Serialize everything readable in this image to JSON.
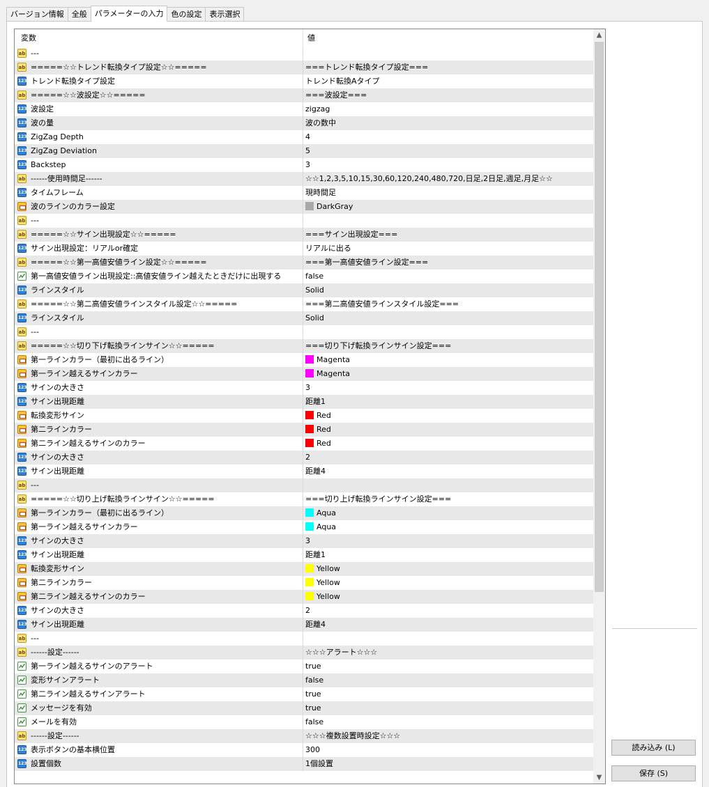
{
  "tabs": [
    {
      "label": "バージョン情報",
      "active": false
    },
    {
      "label": "全般",
      "active": false
    },
    {
      "label": "パラメーターの入力",
      "active": true
    },
    {
      "label": "色の設定",
      "active": false
    },
    {
      "label": "表示選択",
      "active": false
    }
  ],
  "columns": {
    "variable": "変数",
    "value": "値"
  },
  "rows": [
    {
      "type": "string",
      "name": "---",
      "value": ""
    },
    {
      "type": "string",
      "name": "=====☆☆トレンド転換タイプ設定☆☆=====",
      "value": "===トレンド転換タイプ設定==="
    },
    {
      "type": "number",
      "name": "トレンド転換タイプ設定",
      "value": "トレンド転換Aタイプ"
    },
    {
      "type": "string",
      "name": "=====☆☆波設定☆☆=====",
      "value": "===波設定==="
    },
    {
      "type": "number",
      "name": "波設定",
      "value": "zigzag"
    },
    {
      "type": "number",
      "name": "波の量",
      "value": "波の数中"
    },
    {
      "type": "number",
      "name": "ZigZag Depth",
      "value": "4"
    },
    {
      "type": "number",
      "name": "ZigZag Deviation",
      "value": "5"
    },
    {
      "type": "number",
      "name": "Backstep",
      "value": "3"
    },
    {
      "type": "string",
      "name": "------使用時間足------",
      "value": "☆☆1,2,3,5,10,15,30,60,120,240,480,720,日足,2日足,週足,月足☆☆"
    },
    {
      "type": "number",
      "name": "タイムフレーム",
      "value": "現時間足"
    },
    {
      "type": "color",
      "name": "波のラインのカラー設定",
      "value": "DarkGray",
      "swatch": "#a9a9a9"
    },
    {
      "type": "string",
      "name": "---",
      "value": ""
    },
    {
      "type": "string",
      "name": "=====☆☆サイン出現設定☆☆=====",
      "value": "===サイン出現設定==="
    },
    {
      "type": "number",
      "name": "サイン出現設定：リアルor確定",
      "value": "リアルに出る"
    },
    {
      "type": "string",
      "name": "=====☆☆第一高値安値ライン設定☆☆=====",
      "value": "===第一高値安値ライン設定==="
    },
    {
      "type": "bool",
      "name": "第一高値安値ライン出現設定::高値安値ライン越えたときだけに出現する",
      "value": "false"
    },
    {
      "type": "number",
      "name": "ラインスタイル",
      "value": "Solid"
    },
    {
      "type": "string",
      "name": "=====☆☆第二高値安値ラインスタイル設定☆☆=====",
      "value": "===第二高値安値ラインスタイル設定==="
    },
    {
      "type": "number",
      "name": "ラインスタイル",
      "value": "Solid"
    },
    {
      "type": "string",
      "name": "---",
      "value": ""
    },
    {
      "type": "string",
      "name": "=====☆☆切り下げ転換ラインサイン☆☆=====",
      "value": "===切り下げ転換ラインサイン設定==="
    },
    {
      "type": "color",
      "name": "第一ラインカラー（最初に出るライン）",
      "value": "Magenta",
      "swatch": "#ff00ff"
    },
    {
      "type": "color",
      "name": "第一ライン越えるサインカラー",
      "value": "Magenta",
      "swatch": "#ff00ff"
    },
    {
      "type": "number",
      "name": "サインの大きさ",
      "value": "3"
    },
    {
      "type": "number",
      "name": "サイン出現距離",
      "value": "距離1"
    },
    {
      "type": "color",
      "name": "転換変形サイン",
      "value": "Red",
      "swatch": "#ff0000"
    },
    {
      "type": "color",
      "name": "第二ラインカラー",
      "value": "Red",
      "swatch": "#ff0000"
    },
    {
      "type": "color",
      "name": "第二ライン越えるサインのカラー",
      "value": "Red",
      "swatch": "#ff0000"
    },
    {
      "type": "number",
      "name": "サインの大きさ",
      "value": "2"
    },
    {
      "type": "number",
      "name": "サイン出現距離",
      "value": "距離4"
    },
    {
      "type": "string",
      "name": "---",
      "value": ""
    },
    {
      "type": "string",
      "name": "=====☆☆切り上げ転換ラインサイン☆☆=====",
      "value": "===切り上げ転換ラインサイン設定==="
    },
    {
      "type": "color",
      "name": "第一ラインカラー（最初に出るライン）",
      "value": "Aqua",
      "swatch": "#00ffff"
    },
    {
      "type": "color",
      "name": "第一ライン越えるサインカラー",
      "value": "Aqua",
      "swatch": "#00ffff"
    },
    {
      "type": "number",
      "name": "サインの大きさ",
      "value": "3"
    },
    {
      "type": "number",
      "name": "サイン出現距離",
      "value": "距離1"
    },
    {
      "type": "color",
      "name": "転換変形サイン",
      "value": "Yellow",
      "swatch": "#ffff00"
    },
    {
      "type": "color",
      "name": "第二ラインカラー",
      "value": "Yellow",
      "swatch": "#ffff00"
    },
    {
      "type": "color",
      "name": "第二ライン越えるサインのカラー",
      "value": "Yellow",
      "swatch": "#ffff00"
    },
    {
      "type": "number",
      "name": "サインの大きさ",
      "value": "2"
    },
    {
      "type": "number",
      "name": "サイン出現距離",
      "value": "距離4"
    },
    {
      "type": "string",
      "name": "---",
      "value": ""
    },
    {
      "type": "string",
      "name": "------設定------",
      "value": "☆☆☆アラート☆☆☆"
    },
    {
      "type": "bool",
      "name": "第一ライン越えるサインのアラート",
      "value": "true"
    },
    {
      "type": "bool",
      "name": "変形サインアラート",
      "value": "false"
    },
    {
      "type": "bool",
      "name": "第二ライン越えるサインアラート",
      "value": "true"
    },
    {
      "type": "bool",
      "name": "メッセージを有効",
      "value": "true"
    },
    {
      "type": "bool",
      "name": "メールを有効",
      "value": "false"
    },
    {
      "type": "string",
      "name": "------設定------",
      "value": "☆☆☆複数設置時設定☆☆☆"
    },
    {
      "type": "number",
      "name": "表示ボタンの基本横位置",
      "value": "300"
    },
    {
      "type": "number",
      "name": "設置個数",
      "value": "1個設置"
    }
  ],
  "icons": {
    "string": "ab-icon",
    "number": "number-icon",
    "bool": "bool-icon",
    "color": "color-icon"
  },
  "icon_text": {
    "string": "ab",
    "number": "123"
  },
  "buttons": {
    "load": "読み込み (L)",
    "save": "保存 (S)"
  },
  "scroll": {
    "up": "▲",
    "down": "▼"
  }
}
